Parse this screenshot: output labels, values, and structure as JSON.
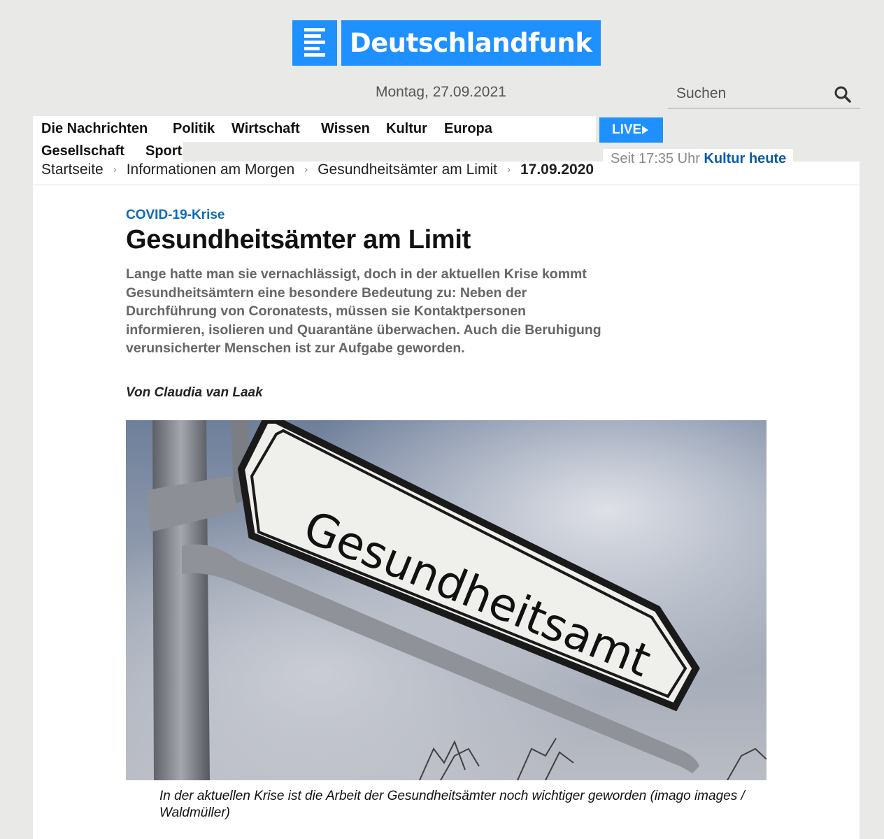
{
  "header": {
    "brand": "Deutschlandfunk",
    "date": "Montag, 27.09.2021",
    "search_placeholder": "Suchen"
  },
  "nav": {
    "items": [
      "Die Nachrichten",
      "Politik",
      "Wirtschaft",
      "Wissen",
      "Kultur",
      "Europa",
      "Gesellschaft",
      "Sport"
    ],
    "live_label": "LIVE"
  },
  "onair": {
    "prefix": "Seit 17:35 Uhr",
    "program": "Kultur heute"
  },
  "breadcrumb": {
    "items": [
      "Startseite",
      "Informationen am Morgen",
      "Gesundheitsämter am Limit"
    ],
    "current": "17.09.2020"
  },
  "article": {
    "kicker": "COVID-19-Krise",
    "headline": "Gesundheitsämter am Limit",
    "teaser": "Lange hatte man sie vernachlässigt, doch in der aktuellen Krise kommt Gesundheitsämtern eine besondere Bedeutung zu: Neben der Durchführung von Coronatests, müssen sie Kontaktpersonen informieren, isolieren und Quarantäne überwachen. Auch die Beruhigung verunsicherter Menschen ist zur Aufgabe geworden.",
    "author": "Von Claudia van Laak",
    "image_sign_text": "Gesundheitsamt",
    "caption": "In der aktuellen Krise ist die Arbeit der Gesundheitsämter noch wichtiger geworden (imago images / Waldmüller)"
  },
  "colors": {
    "brand_blue": "#1e90ff",
    "kicker_blue": "#0b6ab8",
    "link_blue": "#0a5aa8",
    "page_bg": "#e9eae7"
  },
  "icons": [
    "dlf-logo-icon",
    "search-icon",
    "play-icon",
    "breadcrumb-chevron-icon"
  ]
}
